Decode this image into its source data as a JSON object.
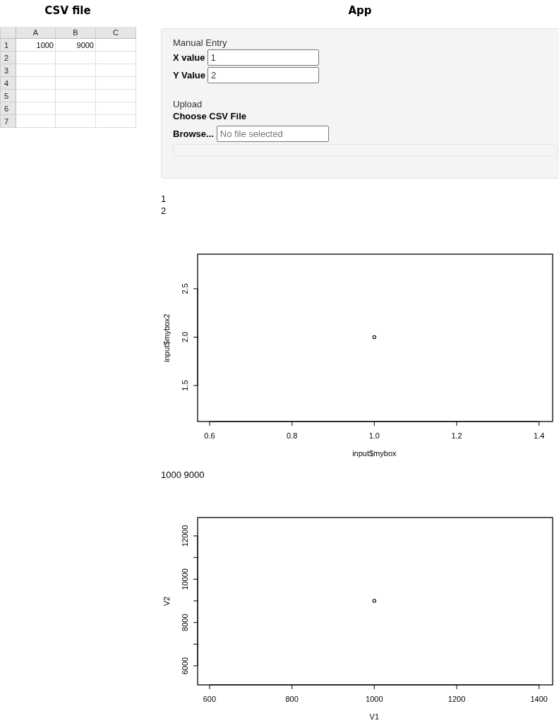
{
  "left_title": "CSV file",
  "right_title": "App",
  "spreadsheet": {
    "columns": [
      "A",
      "B",
      "C"
    ],
    "rows": [
      {
        "number": "1",
        "cells": [
          "1000",
          "9000"
        ]
      },
      {
        "number": "2",
        "cells": []
      },
      {
        "number": "3",
        "cells": []
      },
      {
        "number": "4",
        "cells": []
      },
      {
        "number": "5",
        "cells": []
      },
      {
        "number": "6",
        "cells": []
      },
      {
        "number": "7",
        "cells": []
      }
    ]
  },
  "panel": {
    "manual_heading": "Manual Entry",
    "fields": [
      {
        "label": "X value",
        "value": "1"
      },
      {
        "label": "Y Value",
        "value": "2"
      }
    ],
    "upload_heading": "Upload",
    "file_label": "Choose CSV File",
    "browse": "Browse...",
    "file_placeholder": "No file selected"
  },
  "output_lines": [
    "1",
    "2"
  ],
  "chart1": {
    "chart_data": {
      "type": "scatter",
      "xlabel": "input$mybox",
      "ylabel": "input$mybox2",
      "x": [
        1
      ],
      "values": [
        2
      ],
      "xlim": [
        0.571,
        1.433
      ],
      "ylim": [
        1.128,
        2.857
      ],
      "xticks": [
        0.6,
        0.8,
        {
          "value": 1,
          "label": "1.0"
        },
        1.2,
        1.4
      ],
      "yticks": [
        1.5,
        {
          "value": 2,
          "label": "2.0"
        },
        2.5
      ]
    }
  },
  "csv_output": "1000 9000",
  "chart2": {
    "chart_data": {
      "type": "scatter",
      "xlabel": "V1",
      "ylabel": "V2",
      "x": [
        1000
      ],
      "values": [
        9000
      ],
      "xlim": [
        571,
        1433
      ],
      "ylim": [
        5120,
        12847
      ],
      "xticks": [
        600,
        800,
        1000,
        1200,
        1400
      ],
      "yticks": [
        6000,
        8000,
        10000,
        12000
      ]
    }
  }
}
